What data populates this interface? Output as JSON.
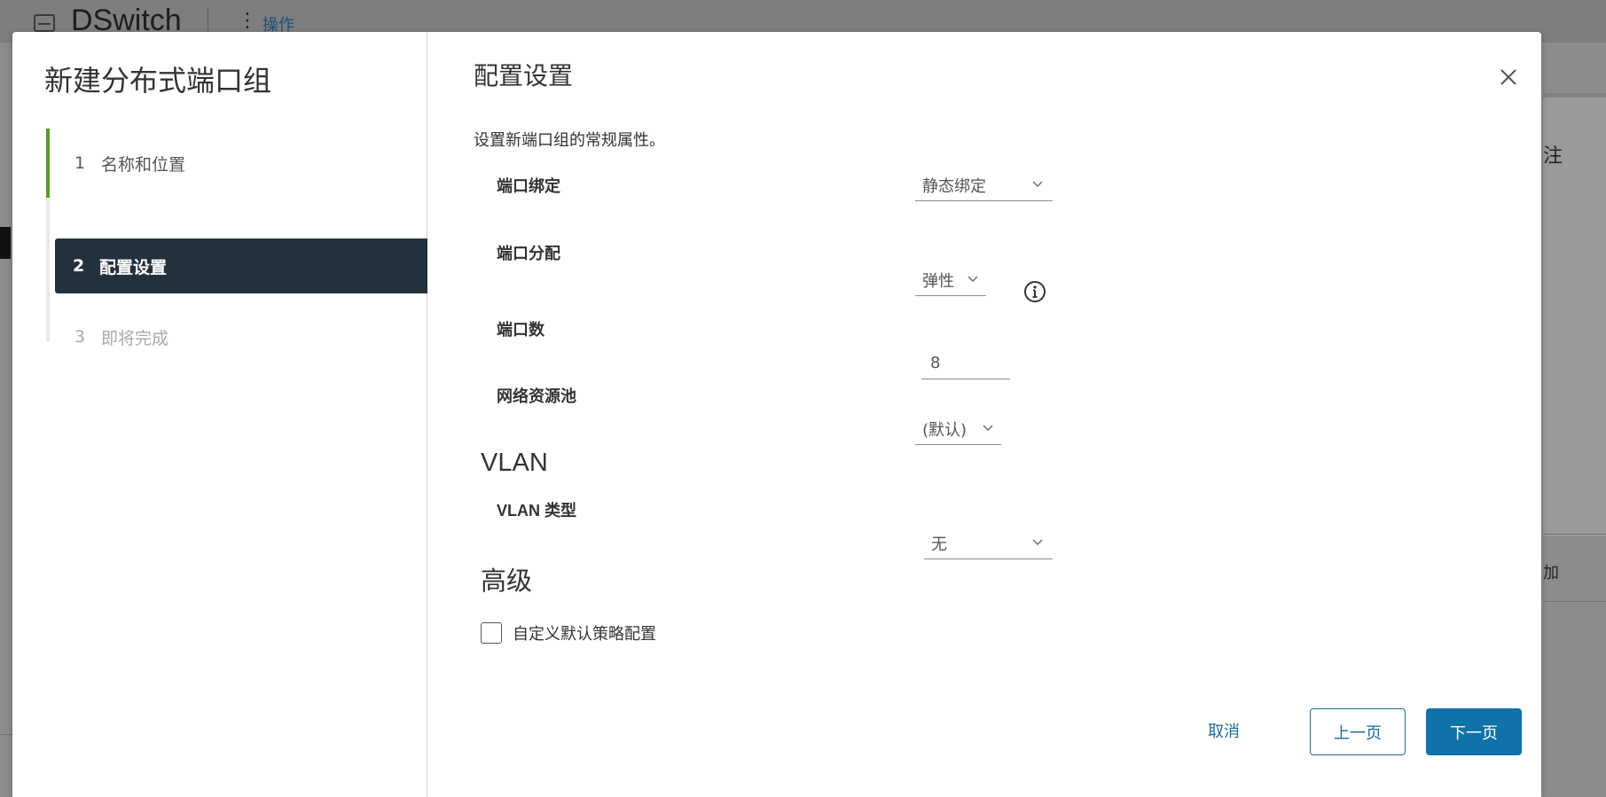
{
  "background": {
    "title": "DSwitch",
    "actions_label": "操作",
    "right_label_1": "注",
    "right_label_2": "加"
  },
  "wizard": {
    "title": "新建分布式端口组",
    "steps": [
      {
        "num": "1",
        "label": "名称和位置",
        "state": "completed"
      },
      {
        "num": "2",
        "label": "配置设置",
        "state": "current"
      },
      {
        "num": "3",
        "label": "即将完成",
        "state": "upcoming"
      }
    ]
  },
  "page": {
    "title": "配置设置",
    "subtitle": "设置新端口组的常规属性。",
    "fields": {
      "port_binding": {
        "label": "端口绑定",
        "value": "静态绑定"
      },
      "port_allocation": {
        "label": "端口分配",
        "value": "弹性"
      },
      "port_count": {
        "label": "端口数",
        "value": "8"
      },
      "network_pool": {
        "label": "网络资源池",
        "value": "(默认)"
      }
    },
    "vlan": {
      "heading": "VLAN",
      "type_label": "VLAN 类型",
      "type_value": "无"
    },
    "advanced": {
      "heading": "高级",
      "checkbox_label": "自定义默认策略配置",
      "checked": false
    }
  },
  "footer": {
    "cancel": "取消",
    "back": "上一页",
    "next": "下一页"
  },
  "colors": {
    "accent": "#0f72a8",
    "active_step_bg": "#23313d",
    "progress": "#5a9a2a"
  }
}
